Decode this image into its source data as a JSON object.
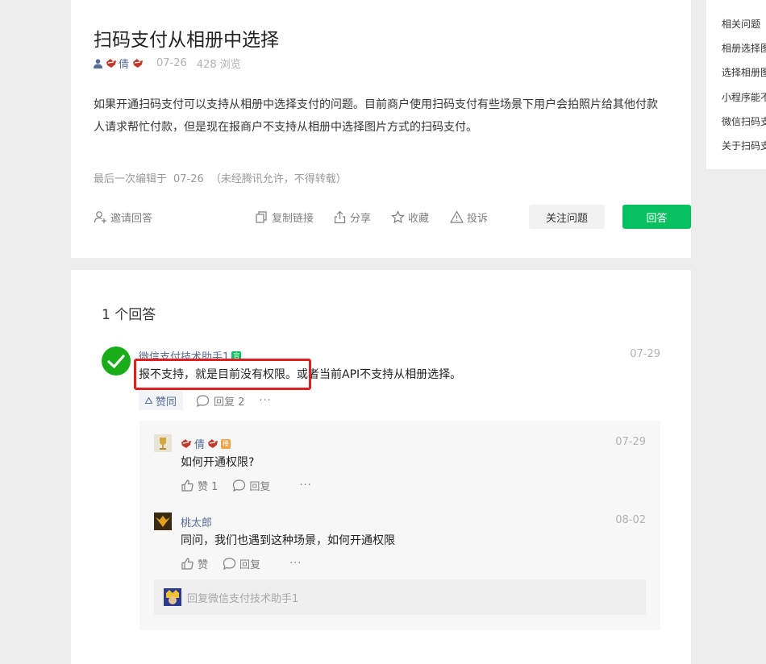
{
  "question": {
    "title": "扫码支付从相册中选择",
    "author": "倩",
    "date": "07-26",
    "views": "428 浏览",
    "body": "如果开通扫码支付可以支持从相册中选择支付的问题。目前商户使用扫码支付有些场景下用户会拍照片给其他付款人请求帮忙付款，但是现在报商户不支持从相册中选择图片方式的扫码支付。",
    "edit_prefix": "最后一次编辑于",
    "edit_date": "07-26",
    "edit_note": "（未经腾讯允许，不得转载）",
    "actions": {
      "invite": "邀请回答",
      "copy_link": "复制链接",
      "share": "分享",
      "collect": "收藏",
      "report": "投诉",
      "follow": "关注问题",
      "answer": "回答"
    }
  },
  "answers": {
    "count_label": "1 个回答",
    "items": [
      {
        "author": "微信支付技术助手1",
        "badge": "官",
        "date": "07-29",
        "text": "报不支持，就是目前没有权限。或者当前API不支持从相册选择。",
        "like_label": "赞同",
        "reply_label": "回复 2",
        "more": "···"
      }
    ]
  },
  "replies": [
    {
      "author": "倩",
      "badge": "楼",
      "date": "07-29",
      "text": "如何开通权限?",
      "like_label": "赞 1",
      "reply_label": "回复",
      "more": "···"
    },
    {
      "author": "桃太郎",
      "date": "08-02",
      "text": "同问，我们也遇到这种场景，如何开通权限",
      "like_label": "赞",
      "reply_label": "回复",
      "more": "···"
    }
  ],
  "reply_input_placeholder": "回复微信支付技术助手1",
  "sidebar": {
    "items": [
      "相关问题",
      "相册选择图",
      "选择相册图",
      "小程序能不",
      "微信扫码支",
      "关于扫码支"
    ]
  },
  "colors": {
    "accent": "#07c160",
    "link": "#576b95",
    "highlight": "#e02020"
  }
}
